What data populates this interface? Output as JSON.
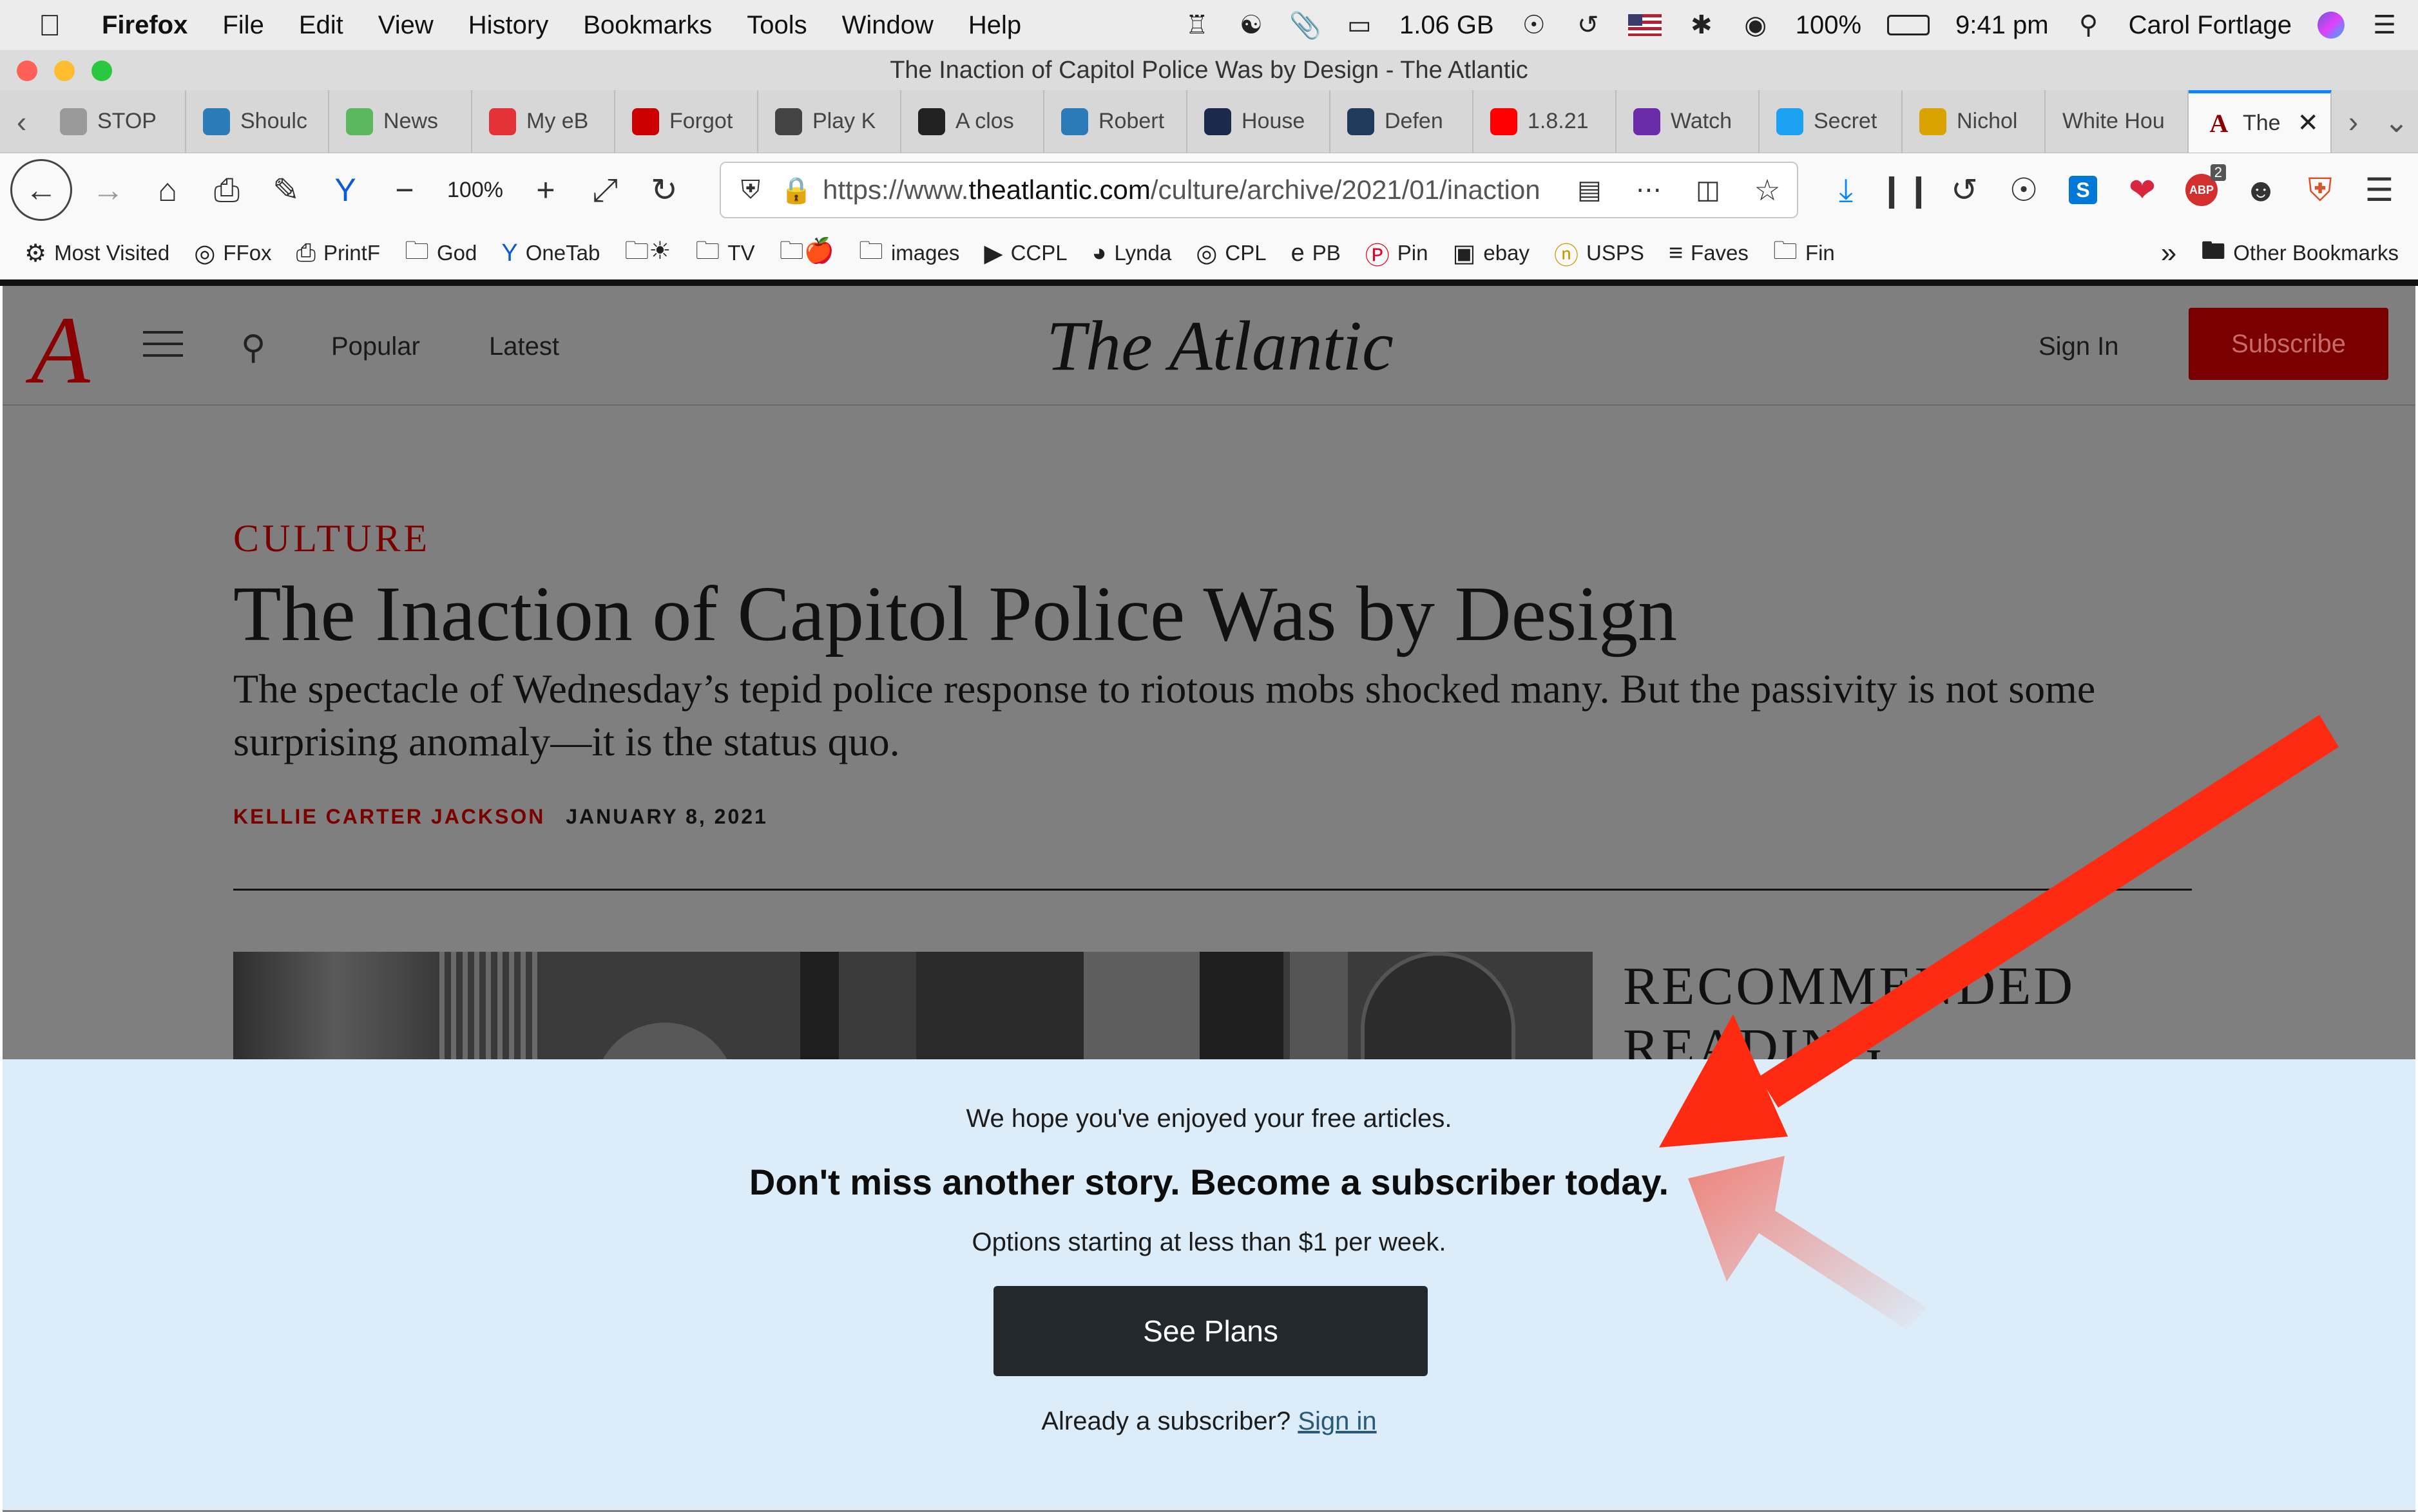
{
  "menubar": {
    "app": "Firefox",
    "items": [
      "File",
      "Edit",
      "View",
      "History",
      "Bookmarks",
      "Tools",
      "Window",
      "Help"
    ],
    "memory": "1.06 GB",
    "battery": "100%",
    "time": "9:41 pm",
    "user": "Carol Fortlage"
  },
  "window": {
    "title": "The Inaction of Capitol Police Was by Design - The Atlantic"
  },
  "tabs": [
    {
      "label": "STOP",
      "icon": "stop-favicon",
      "color": "#9a9a9a"
    },
    {
      "label": "Shoulc",
      "icon": "wordpress-icon",
      "color": "#2b7bb9"
    },
    {
      "label": "News",
      "icon": "newsela-icon",
      "color": "#5cb85c"
    },
    {
      "label": "My eB",
      "icon": "ebay-bag-icon",
      "color": "#e53238"
    },
    {
      "label": "Forgot",
      "icon": "cnet-icon",
      "color": "#cc0000"
    },
    {
      "label": "Play K",
      "icon": "grid-icon",
      "color": "#444444"
    },
    {
      "label": "A clos",
      "icon": "nl-icon",
      "color": "#222222"
    },
    {
      "label": "Robert",
      "icon": "wordpress-icon",
      "color": "#2b7bb9"
    },
    {
      "label": "House",
      "icon": "et-icon",
      "color": "#1b2a4a"
    },
    {
      "label": "Defen",
      "icon": "defense-icon",
      "color": "#1f3b5c"
    },
    {
      "label": "1.8.21",
      "icon": "youtube-icon",
      "color": "#ff0000"
    },
    {
      "label": "Watch",
      "icon": "sp-icon",
      "color": "#6a2ca8"
    },
    {
      "label": "Secret",
      "icon": "twitter-icon",
      "color": "#1da1f2"
    },
    {
      "label": "Nichol",
      "icon": "loop-icon",
      "color": "#d9a400"
    },
    {
      "label": "White Hou",
      "icon": "",
      "color": "#d7d7d7"
    },
    {
      "label": "The",
      "icon": "atlantic-icon",
      "color": "#f9f9fa"
    }
  ],
  "navbar": {
    "zoom": "100%",
    "url": "https://www.theatlantic.com/culture/archive/2021/01/inaction",
    "url_scheme": "https://www.",
    "url_domain": "theatlantic.com",
    "url_path": "/culture/archive/2021/01/inaction",
    "abp_count": "2"
  },
  "bookmarks": [
    {
      "label": "Most Visited",
      "icon": "gear-icon"
    },
    {
      "label": "FFox",
      "icon": "globe-icon"
    },
    {
      "label": "PrintF",
      "icon": "printer-icon"
    },
    {
      "label": "God",
      "icon": "folder-icon"
    },
    {
      "label": "OneTab",
      "icon": "onetab-icon"
    },
    {
      "label": "",
      "icon": "folder-sun-icon"
    },
    {
      "label": "TV",
      "icon": "folder-icon"
    },
    {
      "label": "",
      "icon": "folder-apple-icon"
    },
    {
      "label": "images",
      "icon": "folder-icon"
    },
    {
      "label": "CCPL",
      "icon": "play-icon"
    },
    {
      "label": "Lynda",
      "icon": "lynda-icon"
    },
    {
      "label": "CPL",
      "icon": "globe-icon"
    },
    {
      "label": "PB",
      "icon": "ie-icon"
    },
    {
      "label": "Pin",
      "icon": "pinterest-icon"
    },
    {
      "label": "ebay",
      "icon": "ebay-bag-icon"
    },
    {
      "label": "USPS",
      "icon": "usps-icon"
    },
    {
      "label": "Faves",
      "icon": "amp-icon"
    },
    {
      "label": "Fin",
      "icon": "folder-icon"
    }
  ],
  "other_bookmarks": "Other Bookmarks",
  "site": {
    "logo": "A",
    "nav_popular": "Popular",
    "nav_latest": "Latest",
    "title": "The Atlantic",
    "sign_in": "Sign In",
    "subscribe": "Subscribe"
  },
  "article": {
    "section": "CULTURE",
    "headline": "The Inaction of Capitol Police Was by Design",
    "dek": "The spectacle of Wednesday’s tepid police response to riotous mobs shocked many. But the passivity is not some surprising anomaly—it is the status quo.",
    "author": "KELLIE CARTER JACKSON",
    "date": "JANUARY 8, 2021",
    "recommended": "RECOMMENDED READING"
  },
  "paywall": {
    "line1": "We hope you've enjoyed your free articles.",
    "line2": "Don't miss another story. Become a subscriber today.",
    "line3": "Options starting at less than $1 per week.",
    "cta": "See Plans",
    "already": "Already a subscriber?",
    "signin": "Sign in"
  },
  "colors": {
    "accent_red": "#8b0000",
    "paywall_bg": "#dcecf8",
    "cta_bg": "#23282c",
    "arrow": "#ff2a12"
  }
}
